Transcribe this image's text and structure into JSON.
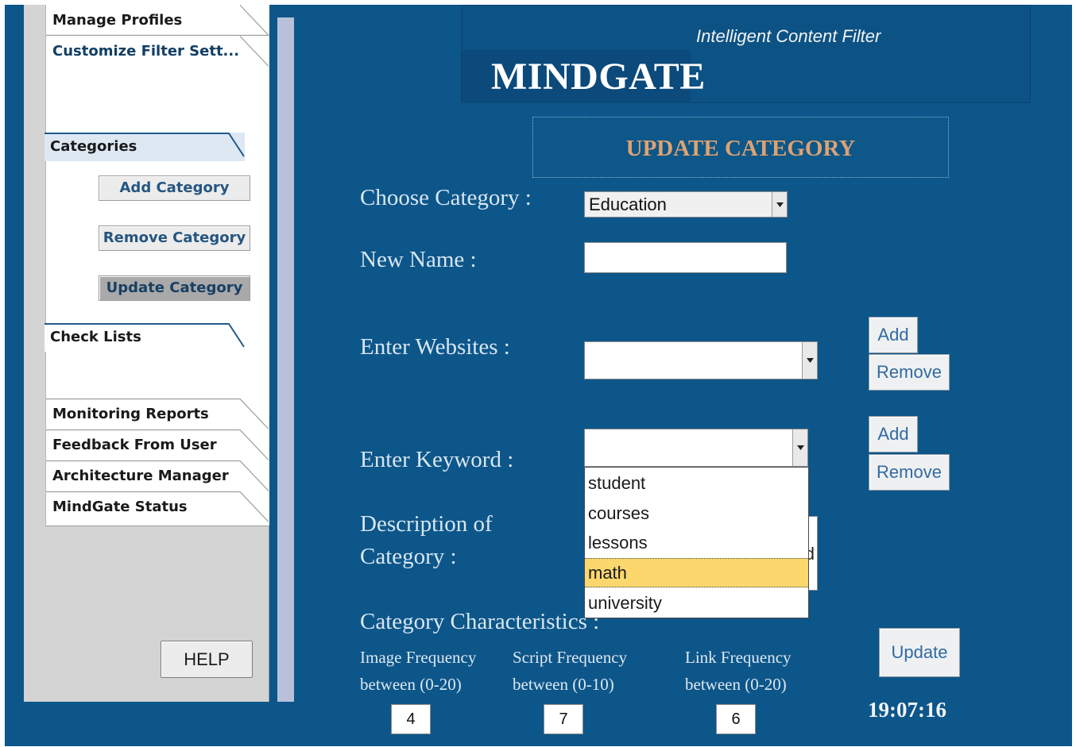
{
  "sidebar": {
    "top_tabs": [
      "Manage Profiles",
      "Customize Filter Sett..."
    ],
    "sections": [
      "Categories",
      "Check Lists"
    ],
    "category_buttons": [
      "Add Category",
      "Remove Category",
      "Update Category"
    ],
    "bottom_tabs": [
      "Monitoring Reports",
      "Feedback From User",
      "Architecture Manager",
      "MindGate Status"
    ],
    "help_label": "HELP"
  },
  "header": {
    "app_title": "MINDGATE",
    "tagline": "Intelligent Content Filter",
    "page_title": "UPDATE CATEGORY"
  },
  "form": {
    "choose_category_label": "Choose Category :",
    "choose_category_value": "Education",
    "new_name_label": "New Name :",
    "new_name_value": "",
    "websites_label": "Enter Websites :",
    "keyword_label": "Enter Keyword :",
    "add_label": "Add",
    "remove_label": "Remove",
    "description_label_line1": "Description of",
    "description_label_line2": "Category :",
    "description_partial_text": "d",
    "keyword_options": [
      "student",
      "courses",
      "lessons",
      "math",
      "university"
    ],
    "keyword_highlighted": "math",
    "characteristics_label": "Category Characteristics :",
    "image_freq_label": "Image Frequency",
    "image_freq_range": "between (0-20)",
    "image_freq_value": "4",
    "script_freq_label": "Script Frequency",
    "script_freq_range": "between (0-10)",
    "script_freq_value": "7",
    "link_freq_label": "Link Frequency",
    "link_freq_range": "between (0-20)",
    "link_freq_value": "6",
    "update_label": "Update"
  },
  "status": {
    "clock": "19:07:16"
  },
  "colors": {
    "background": "#0d568a",
    "heading_accent": "#dfa271",
    "highlight": "#fbd76d",
    "sidebar": "#d4d4d4",
    "button_text": "#326aa0"
  }
}
